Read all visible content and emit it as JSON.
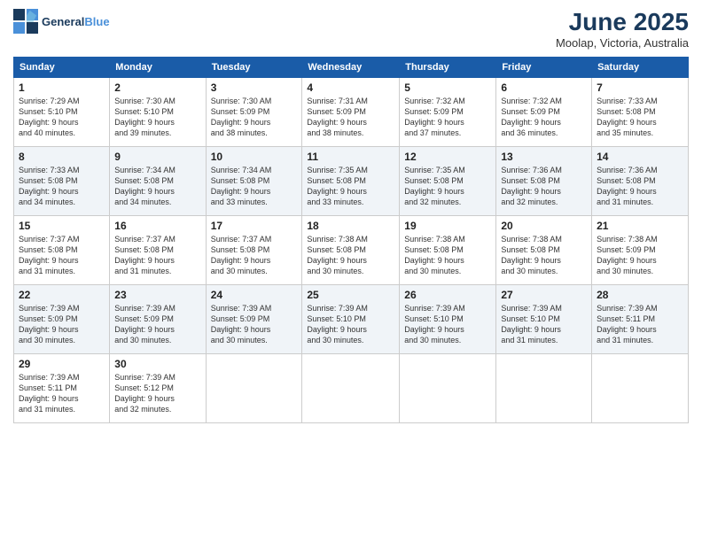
{
  "header": {
    "logo_line1": "General",
    "logo_line2": "Blue",
    "title": "June 2025",
    "subtitle": "Moolap, Victoria, Australia"
  },
  "weekdays": [
    "Sunday",
    "Monday",
    "Tuesday",
    "Wednesday",
    "Thursday",
    "Friday",
    "Saturday"
  ],
  "weeks": [
    [
      {
        "day": "1",
        "sunrise": "7:29 AM",
        "sunset": "5:10 PM",
        "daylight": "9 hours and 40 minutes."
      },
      {
        "day": "2",
        "sunrise": "7:30 AM",
        "sunset": "5:10 PM",
        "daylight": "9 hours and 39 minutes."
      },
      {
        "day": "3",
        "sunrise": "7:30 AM",
        "sunset": "5:09 PM",
        "daylight": "9 hours and 38 minutes."
      },
      {
        "day": "4",
        "sunrise": "7:31 AM",
        "sunset": "5:09 PM",
        "daylight": "9 hours and 38 minutes."
      },
      {
        "day": "5",
        "sunrise": "7:32 AM",
        "sunset": "5:09 PM",
        "daylight": "9 hours and 37 minutes."
      },
      {
        "day": "6",
        "sunrise": "7:32 AM",
        "sunset": "5:09 PM",
        "daylight": "9 hours and 36 minutes."
      },
      {
        "day": "7",
        "sunrise": "7:33 AM",
        "sunset": "5:08 PM",
        "daylight": "9 hours and 35 minutes."
      }
    ],
    [
      {
        "day": "8",
        "sunrise": "7:33 AM",
        "sunset": "5:08 PM",
        "daylight": "9 hours and 34 minutes."
      },
      {
        "day": "9",
        "sunrise": "7:34 AM",
        "sunset": "5:08 PM",
        "daylight": "9 hours and 34 minutes."
      },
      {
        "day": "10",
        "sunrise": "7:34 AM",
        "sunset": "5:08 PM",
        "daylight": "9 hours and 33 minutes."
      },
      {
        "day": "11",
        "sunrise": "7:35 AM",
        "sunset": "5:08 PM",
        "daylight": "9 hours and 33 minutes."
      },
      {
        "day": "12",
        "sunrise": "7:35 AM",
        "sunset": "5:08 PM",
        "daylight": "9 hours and 32 minutes."
      },
      {
        "day": "13",
        "sunrise": "7:36 AM",
        "sunset": "5:08 PM",
        "daylight": "9 hours and 32 minutes."
      },
      {
        "day": "14",
        "sunrise": "7:36 AM",
        "sunset": "5:08 PM",
        "daylight": "9 hours and 31 minutes."
      }
    ],
    [
      {
        "day": "15",
        "sunrise": "7:37 AM",
        "sunset": "5:08 PM",
        "daylight": "9 hours and 31 minutes."
      },
      {
        "day": "16",
        "sunrise": "7:37 AM",
        "sunset": "5:08 PM",
        "daylight": "9 hours and 31 minutes."
      },
      {
        "day": "17",
        "sunrise": "7:37 AM",
        "sunset": "5:08 PM",
        "daylight": "9 hours and 30 minutes."
      },
      {
        "day": "18",
        "sunrise": "7:38 AM",
        "sunset": "5:08 PM",
        "daylight": "9 hours and 30 minutes."
      },
      {
        "day": "19",
        "sunrise": "7:38 AM",
        "sunset": "5:08 PM",
        "daylight": "9 hours and 30 minutes."
      },
      {
        "day": "20",
        "sunrise": "7:38 AM",
        "sunset": "5:08 PM",
        "daylight": "9 hours and 30 minutes."
      },
      {
        "day": "21",
        "sunrise": "7:38 AM",
        "sunset": "5:09 PM",
        "daylight": "9 hours and 30 minutes."
      }
    ],
    [
      {
        "day": "22",
        "sunrise": "7:39 AM",
        "sunset": "5:09 PM",
        "daylight": "9 hours and 30 minutes."
      },
      {
        "day": "23",
        "sunrise": "7:39 AM",
        "sunset": "5:09 PM",
        "daylight": "9 hours and 30 minutes."
      },
      {
        "day": "24",
        "sunrise": "7:39 AM",
        "sunset": "5:09 PM",
        "daylight": "9 hours and 30 minutes."
      },
      {
        "day": "25",
        "sunrise": "7:39 AM",
        "sunset": "5:10 PM",
        "daylight": "9 hours and 30 minutes."
      },
      {
        "day": "26",
        "sunrise": "7:39 AM",
        "sunset": "5:10 PM",
        "daylight": "9 hours and 30 minutes."
      },
      {
        "day": "27",
        "sunrise": "7:39 AM",
        "sunset": "5:10 PM",
        "daylight": "9 hours and 31 minutes."
      },
      {
        "day": "28",
        "sunrise": "7:39 AM",
        "sunset": "5:11 PM",
        "daylight": "9 hours and 31 minutes."
      }
    ],
    [
      {
        "day": "29",
        "sunrise": "7:39 AM",
        "sunset": "5:11 PM",
        "daylight": "9 hours and 31 minutes."
      },
      {
        "day": "30",
        "sunrise": "7:39 AM",
        "sunset": "5:12 PM",
        "daylight": "9 hours and 32 minutes."
      },
      null,
      null,
      null,
      null,
      null
    ]
  ],
  "labels": {
    "sunrise": "Sunrise:",
    "sunset": "Sunset:",
    "daylight": "Daylight:"
  }
}
